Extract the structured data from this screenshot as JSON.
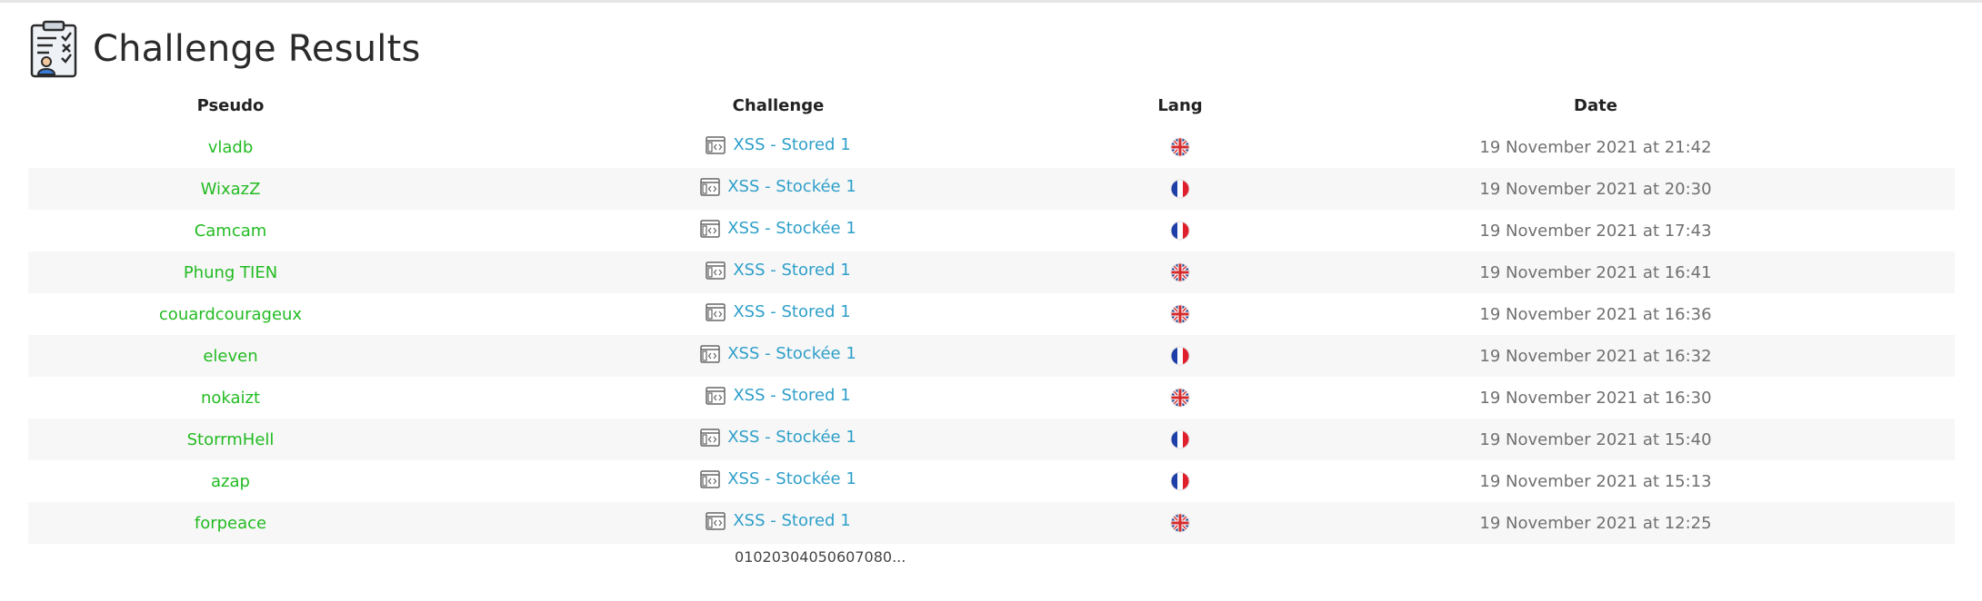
{
  "page": {
    "title": "Challenge Results",
    "logo_icon": "clipboard-results-icon"
  },
  "table": {
    "headers": {
      "pseudo": "Pseudo",
      "challenge": "Challenge",
      "lang": "Lang",
      "date": "Date"
    },
    "rows": [
      {
        "pseudo": "vladb",
        "challenge": "XSS - Stored 1",
        "lang": "en",
        "date": "19 November 2021 at 21:42"
      },
      {
        "pseudo": "WixazZ",
        "challenge": "XSS - Stockée 1",
        "lang": "fr",
        "date": "19 November 2021 at 20:30"
      },
      {
        "pseudo": "Camcam",
        "challenge": "XSS - Stockée 1",
        "lang": "fr",
        "date": "19 November 2021 at 17:43"
      },
      {
        "pseudo": "Phung TIEN",
        "challenge": "XSS - Stored 1",
        "lang": "en",
        "date": "19 November 2021 at 16:41"
      },
      {
        "pseudo": "couardcourageux",
        "challenge": "XSS - Stored 1",
        "lang": "en",
        "date": "19 November 2021 at 16:36"
      },
      {
        "pseudo": "eleven",
        "challenge": "XSS - Stockée 1",
        "lang": "fr",
        "date": "19 November 2021 at 16:32"
      },
      {
        "pseudo": "nokaizt",
        "challenge": "XSS - Stored 1",
        "lang": "en",
        "date": "19 November 2021 at 16:30"
      },
      {
        "pseudo": "StorrmHell",
        "challenge": "XSS - Stockée 1",
        "lang": "fr",
        "date": "19 November 2021 at 15:40"
      },
      {
        "pseudo": "azap",
        "challenge": "XSS - Stockée 1",
        "lang": "fr",
        "date": "19 November 2021 at 15:13"
      },
      {
        "pseudo": "forpeace",
        "challenge": "XSS - Stored 1",
        "lang": "en",
        "date": "19 November 2021 at 12:25"
      }
    ]
  },
  "pagination": {
    "pages": [
      "0",
      "10",
      "20",
      "30",
      "40",
      "50",
      "60",
      "70",
      "80",
      "..."
    ],
    "active": "0"
  },
  "colors": {
    "pseudo": "#22bb22",
    "challenge": "#2e9fc9",
    "date": "#707070",
    "stripe": "#f7f7f7"
  },
  "icons": {
    "challenge": "web-client-icon",
    "lang_en": "uk-flag-icon",
    "lang_fr": "france-flag-icon"
  }
}
